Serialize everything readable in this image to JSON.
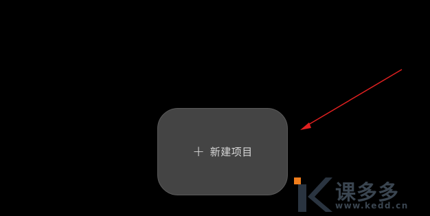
{
  "new_project_button": {
    "icon": "plus-icon",
    "plus_glyph": "+",
    "label": "新建项目"
  },
  "annotation": {
    "arrow_color": "#e02020"
  },
  "watermark": {
    "brand": "课多多",
    "url": "www.kedd.cn",
    "logo_colors": [
      "#f07d1c",
      "#2a3440"
    ]
  }
}
